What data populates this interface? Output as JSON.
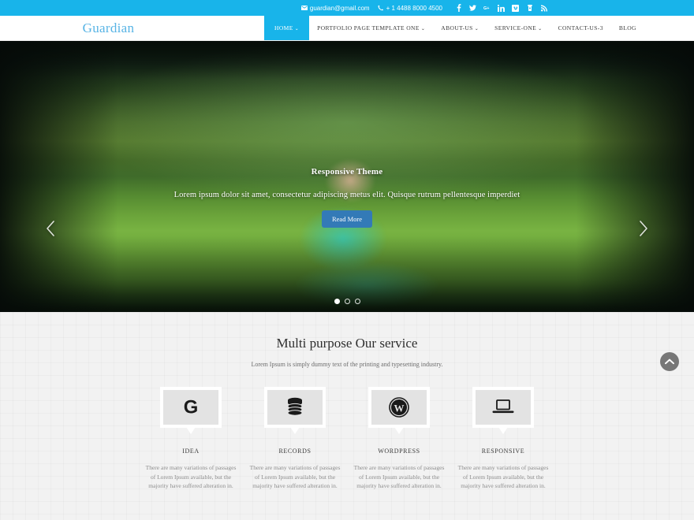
{
  "topbar": {
    "email": "guardian@gmail.com",
    "phone": "+ 1 4488 8000 4500",
    "email_icon": "envelope-icon",
    "phone_icon": "phone-icon",
    "socials": [
      {
        "name": "facebook-icon",
        "label": "f"
      },
      {
        "name": "twitter-icon",
        "label": "t"
      },
      {
        "name": "google-plus-icon",
        "label": "G+"
      },
      {
        "name": "linkedin-icon",
        "label": "in"
      },
      {
        "name": "vimeo-square-icon",
        "label": "v"
      },
      {
        "name": "youtube-icon",
        "label": "yt"
      },
      {
        "name": "rss-icon",
        "label": "rss"
      }
    ]
  },
  "header": {
    "logo": "Guardian",
    "nav": [
      {
        "label": "HOME",
        "caret": "⌄",
        "active": true
      },
      {
        "label": "PORTFOLIO PAGE TEMPLATE ONE",
        "caret": "⌄",
        "active": false
      },
      {
        "label": "ABOUT-US",
        "caret": "⌄",
        "active": false
      },
      {
        "label": "SERVICE-ONE",
        "caret": "⌄",
        "active": false
      },
      {
        "label": "CONTACT-US-3",
        "caret": "",
        "active": false
      },
      {
        "label": "BLOG",
        "caret": "",
        "active": false
      }
    ]
  },
  "hero": {
    "title": "Responsive Theme",
    "subtitle": "Lorem ipsum dolor sit amet, consectetur adipiscing metus elit. Quisque rutrum pellentesque imperdiet",
    "button": "Read More",
    "prev_label": "‹",
    "next_label": "›",
    "slides": [
      {
        "active": true
      },
      {
        "active": false
      },
      {
        "active": false
      }
    ]
  },
  "services": {
    "heading": "Multi purpose Our service",
    "subheading": "Lorem Ipsum is simply dummy text of the printing and typesetting industry.",
    "items": [
      {
        "label": "IDEA",
        "icon": "google-g-icon",
        "text": "There are many variations of passages of Lorem Ipsum available, but the majority have suffered alteration in."
      },
      {
        "label": "RECORDS",
        "icon": "database-icon",
        "text": "There are many variations of passages of Lorem Ipsum available, but the majority have suffered alteration in."
      },
      {
        "label": "WORDPRESS",
        "icon": "wordpress-icon",
        "text": "There are many variations of passages of Lorem Ipsum available, but the majority have suffered alteration in."
      },
      {
        "label": "RESPONSIVE",
        "icon": "laptop-icon",
        "text": "There are many variations of passages of Lorem Ipsum available, but the majority have suffered alteration in."
      }
    ]
  },
  "scroll_top": {
    "icon": "chevron-up-icon"
  },
  "colors": {
    "accent": "#18b4ea",
    "logo": "#58b4e5",
    "button": "#337ab7",
    "section_bg": "#f2f2f2",
    "icon_box": "#e3e3e3",
    "scroll_top": "#777777"
  }
}
